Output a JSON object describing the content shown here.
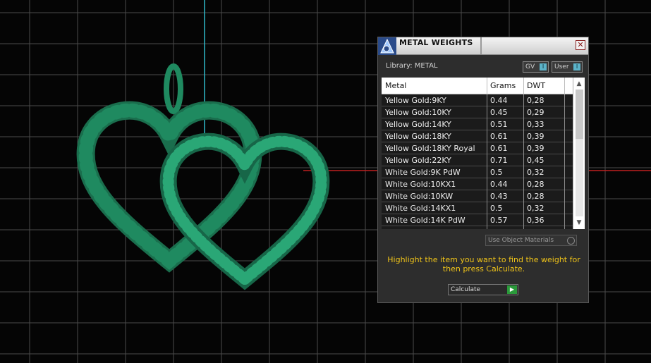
{
  "panel": {
    "title": "METAL WEIGHTS",
    "close_glyph": "✕",
    "library_label": "Library: METAL",
    "toggle_gv": "GV",
    "toggle_user": "User",
    "use_object_materials": "Use Object Materials",
    "hint": "Highlight the item you want to find the weight for then press Calculate.",
    "calculate_label": "Calculate",
    "columns": {
      "metal": "Metal",
      "grams": "Grams",
      "dwt": "DWT"
    },
    "rows": [
      {
        "metal": "Yellow Gold:9KY",
        "grams": "0.44",
        "dwt": "0,28"
      },
      {
        "metal": "Yellow Gold:10KY",
        "grams": "0.45",
        "dwt": "0,29"
      },
      {
        "metal": "Yellow Gold:14KY",
        "grams": "0.51",
        "dwt": "0,33"
      },
      {
        "metal": "Yellow Gold:18KY",
        "grams": "0.61",
        "dwt": "0,39"
      },
      {
        "metal": "Yellow Gold:18KY Royal",
        "grams": "0.61",
        "dwt": "0,39"
      },
      {
        "metal": "Yellow Gold:22KY",
        "grams": "0.71",
        "dwt": "0,45"
      },
      {
        "metal": "White Gold:9K PdW",
        "grams": "0.5",
        "dwt": "0,32"
      },
      {
        "metal": "White Gold:10KX1",
        "grams": "0.44",
        "dwt": "0,28"
      },
      {
        "metal": "White Gold:10KW",
        "grams": "0.43",
        "dwt": "0,28"
      },
      {
        "metal": "White Gold:14KX1",
        "grams": "0.5",
        "dwt": "0,32"
      },
      {
        "metal": "White Gold:14K PdW",
        "grams": "0.57",
        "dwt": "0,36"
      }
    ],
    "icons": {
      "logo": "app-logo-icon",
      "scroll_up": "scroll-up-icon",
      "scroll_down": "scroll-down-icon",
      "go": "play-arrow-icon"
    }
  },
  "viewport": {
    "model": "double-heart-pendant",
    "model_color": "#1f8a60"
  }
}
